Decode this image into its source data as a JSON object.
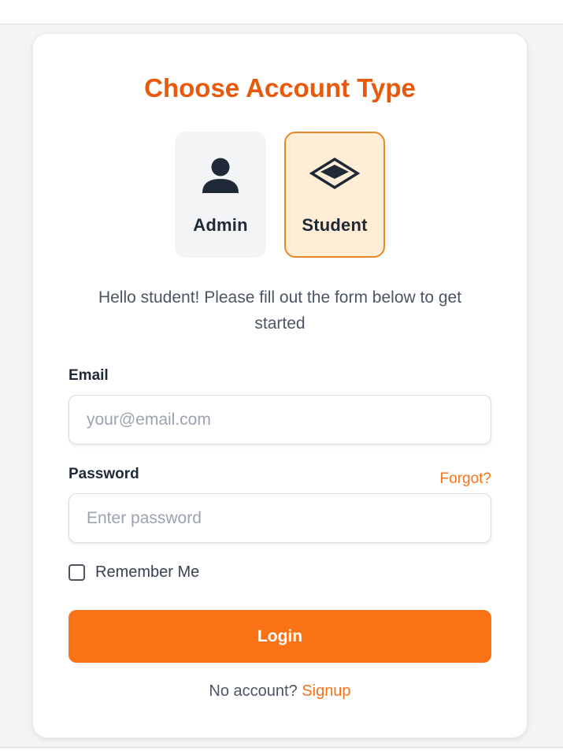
{
  "title": "Choose Account Type",
  "account_types": [
    {
      "label": "Admin",
      "icon": "user-icon",
      "selected": false
    },
    {
      "label": "Student",
      "icon": "layers-icon",
      "selected": true
    }
  ],
  "intro": "Hello student! Please fill out the form below to get started",
  "form": {
    "email_label": "Email",
    "email_placeholder": "your@email.com",
    "email_value": "",
    "password_label": "Password",
    "password_placeholder": "Enter password",
    "password_value": "",
    "forgot_label": "Forgot?",
    "remember_label": "Remember Me",
    "remember_checked": false,
    "login_label": "Login"
  },
  "signup": {
    "prompt": "No account?",
    "link_label": "Signup"
  },
  "colors": {
    "accent": "#f97316",
    "title": "#e8590c",
    "selected_bg": "#ffedd5",
    "selected_border": "#e8862a",
    "unselected_bg": "#f3f4f6"
  }
}
